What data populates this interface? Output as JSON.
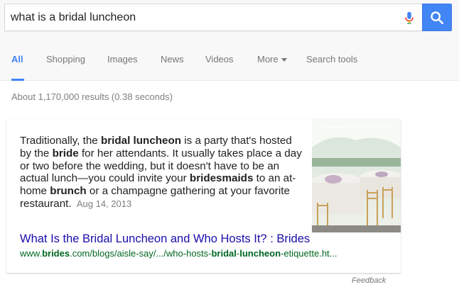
{
  "search": {
    "query": "what is a bridal luncheon",
    "placeholder": "",
    "mic_icon": "microphone-icon",
    "search_icon": "search-icon",
    "button_color": "#4285f4"
  },
  "tabs": [
    {
      "label": "All",
      "active": true
    },
    {
      "label": "Shopping",
      "active": false
    },
    {
      "label": "Images",
      "active": false
    },
    {
      "label": "News",
      "active": false
    },
    {
      "label": "Videos",
      "active": false
    },
    {
      "label": "More",
      "active": false,
      "icon": "caret-down-icon"
    },
    {
      "label": "Search tools",
      "active": false
    }
  ],
  "result_stats": "About 1,170,000 results (0.38 seconds)",
  "featured": {
    "snippet": {
      "p1": "Traditionally, the ",
      "b1": "bridal luncheon",
      "p2": " is a party that's hosted by the ",
      "b2": "bride",
      "p3": " for her attendants. It usually takes place a day or two before the wedding, but it doesn't have to be an actual lunch—you could invite your ",
      "b3": "bridesmaids",
      "p4": " to an at-home ",
      "b4": "brunch",
      "p5": " or a champagne gathering at your favorite restaurant.",
      "date": "Aug 14, 2013"
    },
    "image": "wedding-reception-tables-photo",
    "title": "What Is the Bridal Luncheon and Who Hosts It? : Brides",
    "url": {
      "u1": "www.",
      "u2": "brides",
      "u3": ".com/blogs/aisle-say/.../who-hosts-",
      "u4": "bridal",
      "u5": "-",
      "u6": "luncheon",
      "u7": "-etiquette.ht..."
    },
    "title_color": "#1a0dab",
    "url_color": "#006621"
  },
  "feedback": "Feedback"
}
